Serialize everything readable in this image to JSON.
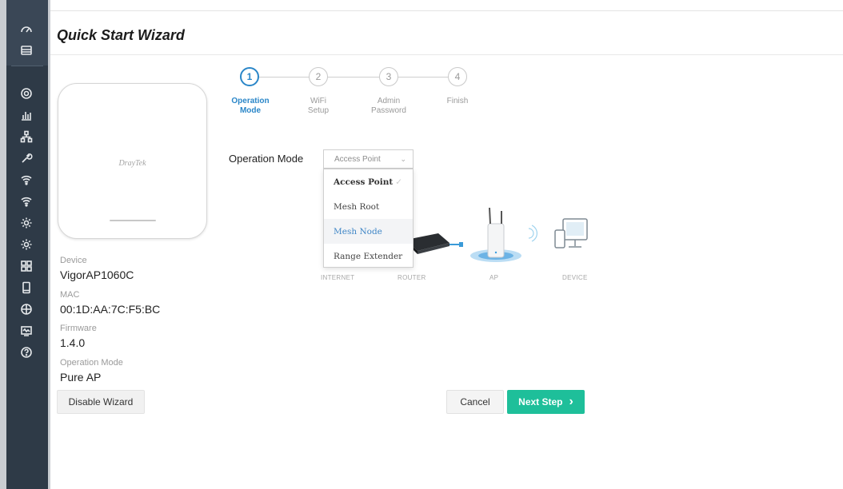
{
  "page": {
    "title": "Quick Start Wizard"
  },
  "sidebar": {
    "icons": [
      "dashboard-icon",
      "wizard-icon",
      "radar-icon",
      "bar-chart-icon",
      "network-icon",
      "tools-icon",
      "wifi-icon",
      "wifi-2-icon",
      "settings-icon",
      "settings-2-icon",
      "apps-icon",
      "mobile-icon",
      "shield-icon",
      "monitor-icon",
      "help-icon"
    ]
  },
  "device": {
    "logo": "DrayTek",
    "device_label": "Device",
    "device_value": "VigorAP1060C",
    "mac_label": "MAC",
    "mac_value": "00:1D:AA:7C:F5:BC",
    "firmware_label": "Firmware",
    "firmware_value": "1.4.0",
    "opmode_label": "Operation Mode",
    "opmode_value": "Pure AP"
  },
  "steps": [
    {
      "number": "1",
      "label_line1": "Operation",
      "label_line2": "Mode",
      "active": true
    },
    {
      "number": "2",
      "label_line1": "WiFi",
      "label_line2": "Setup",
      "active": false
    },
    {
      "number": "3",
      "label_line1": "Admin",
      "label_line2": "Password",
      "active": false
    },
    {
      "number": "4",
      "label_line1": "Finish",
      "label_line2": "",
      "active": false
    }
  ],
  "operation_mode": {
    "label": "Operation Mode",
    "selected": "Access Point",
    "options": [
      "Access Point",
      "Mesh Root",
      "Mesh Node",
      "Range Extender"
    ],
    "highlighted": "Mesh Node"
  },
  "diagram": {
    "labels": [
      "INTERNET",
      "ROUTER",
      "AP",
      "DEVICE"
    ]
  },
  "buttons": {
    "disable_wizard": "Disable Wizard",
    "cancel": "Cancel",
    "next_step": "Next Step",
    "next_chevron": "›"
  },
  "colors": {
    "accent": "#2a86c8",
    "next_button": "#1ebf9a",
    "sidebar": "#2e3a47"
  }
}
